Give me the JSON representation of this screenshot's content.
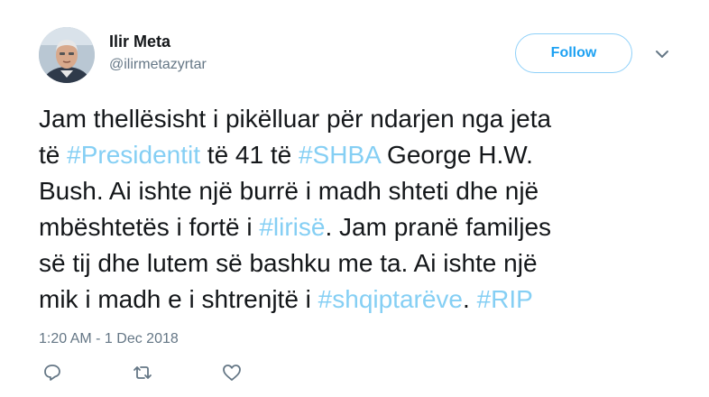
{
  "author": {
    "name": "Ilir Meta",
    "handle": "@ilirmetazyrtar"
  },
  "follow_label": "Follow",
  "tweet": {
    "lines": [
      [
        {
          "t": "Jam thellësisht i pikëlluar për ndarjen nga jeta"
        }
      ],
      [
        {
          "t": "të "
        },
        {
          "t": "#Presidentit",
          "tag": true
        },
        {
          "t": " të 41 të "
        },
        {
          "t": "#SHBA",
          "tag": true
        },
        {
          "t": " George H.W."
        }
      ],
      [
        {
          "t": "Bush. Ai ishte një burrë i madh shteti dhe një"
        }
      ],
      [
        {
          "t": "mbështetës i fortë i "
        },
        {
          "t": "#lirisë",
          "tag": true
        },
        {
          "t": ". Jam pranë familjes"
        }
      ],
      [
        {
          "t": "së tij dhe lutem së bashku me ta. Ai ishte një"
        }
      ],
      [
        {
          "t": "mik i madh e i shtrenjtë i "
        },
        {
          "t": "#shqiptarëve",
          "tag": true
        },
        {
          "t": ". "
        },
        {
          "t": "#RIP",
          "tag": true
        }
      ]
    ]
  },
  "timestamp": "1:20 AM - 1 Dec 2018",
  "icons": {
    "chevron": "chevron-down-icon",
    "reply": "reply-icon",
    "retweet": "retweet-icon",
    "like": "heart-icon"
  },
  "colors": {
    "accent": "#1da1f2",
    "hashtag": "#85cff4",
    "text": "#14171a",
    "muted": "#657786"
  }
}
